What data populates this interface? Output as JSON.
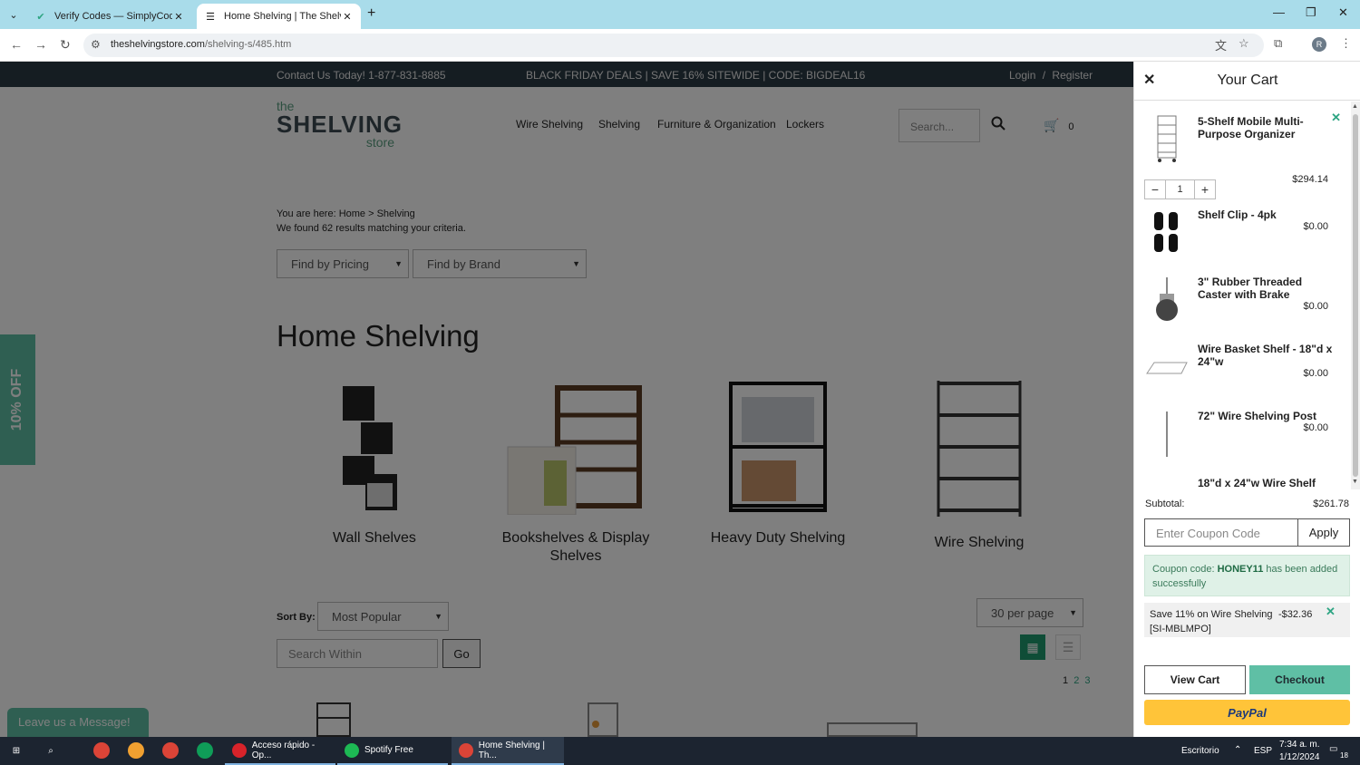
{
  "browser": {
    "tabs": [
      {
        "title": "Verify Codes — SimplyCodes",
        "active": false
      },
      {
        "title": "Home Shelving | The Shelving S",
        "active": true
      }
    ],
    "url_host": "theshelvingstore.com",
    "url_path": "/shelving-s/485.htm",
    "profile_initial": "R"
  },
  "site": {
    "contact": "Contact Us Today! 1-877-831-8885",
    "deal": "BLACK FRIDAY DEALS | SAVE 16% SITEWIDE | CODE: BIGDEAL16",
    "login": "Login",
    "auth_sep": "/",
    "register": "Register",
    "logo": {
      "the": "the",
      "shelving": "SHELVING",
      "store": "store"
    },
    "nav": [
      "Wire Shelving",
      "Shelving",
      "Furniture & Organization",
      "Lockers"
    ],
    "search_placeholder": "Search...",
    "cart_count": "0",
    "breadcrumb": "You are here: Home > Shelving",
    "found": "We found 62 results matching your criteria.",
    "filter_pricing": "Find by Pricing",
    "filter_brand": "Find by Brand",
    "heading": "Home Shelving",
    "categories": [
      "Wall Shelves",
      "Bookshelves & Display Shelves",
      "Heavy Duty Shelving",
      "Wire Shelving"
    ],
    "sort_label": "Sort By:",
    "sort_value": "Most Popular",
    "per_page": "30 per page",
    "search_within": "Search Within",
    "go": "Go",
    "pages": [
      "1",
      "2",
      "3"
    ],
    "promo_tab": "10% OFF",
    "chat": "Leave us a Message!"
  },
  "cart": {
    "title": "Your Cart",
    "items": [
      {
        "name": "5-Shelf Mobile Multi-Purpose Organizer",
        "price": "$294.14",
        "qty": "1"
      },
      {
        "name": "Shelf Clip - 4pk",
        "price": "$0.00"
      },
      {
        "name": "3\" Rubber Threaded Caster with Brake",
        "price": "$0.00"
      },
      {
        "name": "Wire Basket Shelf - 18\"d x 24\"w",
        "price": "$0.00"
      },
      {
        "name": "72\" Wire Shelving Post",
        "price": "$0.00"
      },
      {
        "name": "18\"d x 24\"w Wire Shelf",
        "price": ""
      }
    ],
    "subtotal_label": "Subtotal:",
    "subtotal": "$261.78",
    "coupon_placeholder": "Enter Coupon Code",
    "apply": "Apply",
    "success_prefix": "Coupon code:",
    "success_code": "HONEY11",
    "success_suffix": "has been added successfully",
    "discount_text": "Save 11% on Wire Shelving [SI-MBLMPO]",
    "discount_amount": "-$32.36",
    "view_cart": "View Cart",
    "checkout": "Checkout",
    "paypal": "PayPal"
  },
  "taskbar": {
    "apps": [
      "Acceso rápido - Op...",
      "Spotify Free",
      "Home Shelving | Th..."
    ],
    "desktop": "Escritorio",
    "lang": "ESP",
    "time": "7:34 a. m.",
    "date": "1/12/2024",
    "notif_count": "18"
  },
  "colors": {
    "accent": "#5fbfa5",
    "dark_strip": "#2b3a45",
    "paypal": "#ffc439",
    "tabbar": "#a9dcea"
  }
}
